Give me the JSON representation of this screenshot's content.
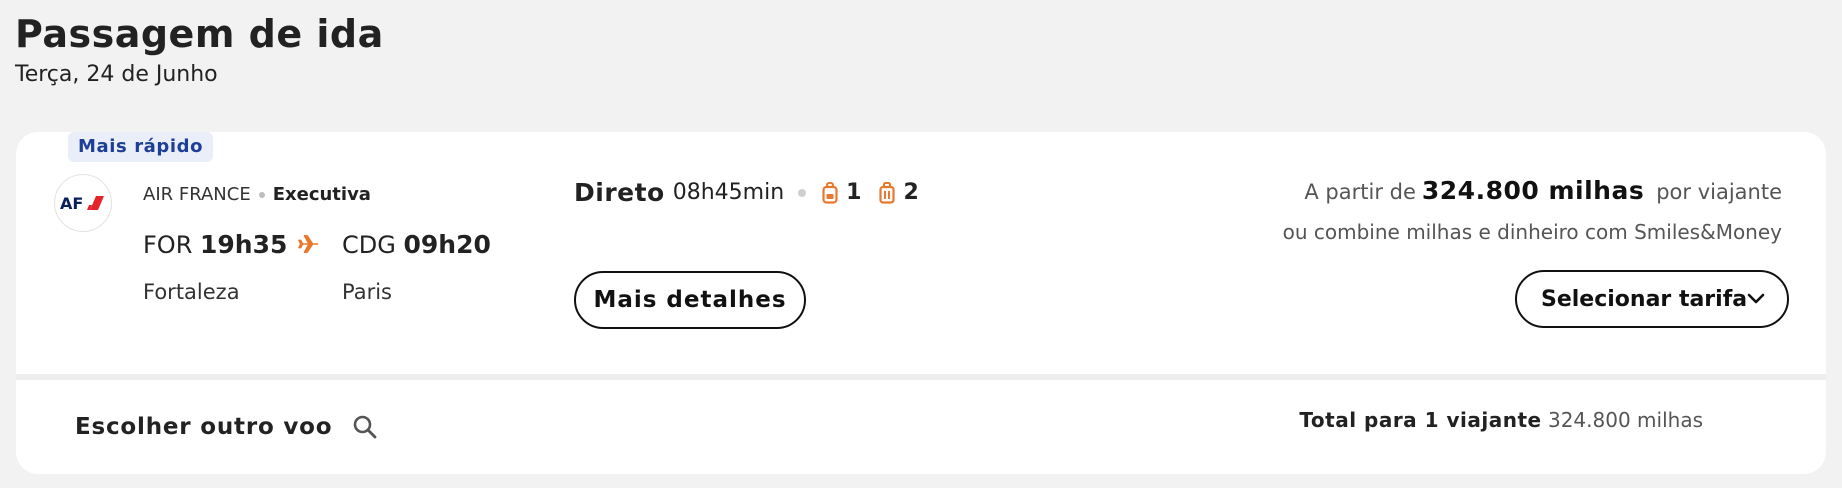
{
  "header": {
    "title": "Passagem de ida",
    "date": "Terça, 24 de Junho"
  },
  "flight": {
    "badge": "Mais rápido",
    "airline_logo_icon": "air-france-logo",
    "airline": "AIR FRANCE",
    "cabin": "Executiva",
    "departure": {
      "code": "FOR",
      "time": "19h35",
      "city": "Fortaleza"
    },
    "arrival": {
      "code": "CDG",
      "time": "09h20",
      "city": "Paris"
    },
    "stops": "Direto",
    "duration": "08h45min",
    "carry_on_count": "1",
    "checked_bag_count": "2",
    "details_button": "Mais detalhes"
  },
  "price": {
    "prefix": "A partir de",
    "amount": "324.800 milhas",
    "suffix": "por viajante",
    "combine_text": "ou combine milhas e dinheiro com Smiles&Money",
    "select_button": "Selecionar tarifa"
  },
  "footer": {
    "other_flight": "Escolher outro voo",
    "total_label": "Total para 1 viajante",
    "total_amount": "324.800 milhas"
  },
  "colors": {
    "accent_orange": "#e8782d",
    "badge_bg": "#e9eef9",
    "badge_text": "#1d3f96",
    "af_blue": "#0a1f5c",
    "af_red": "#e3242b"
  }
}
